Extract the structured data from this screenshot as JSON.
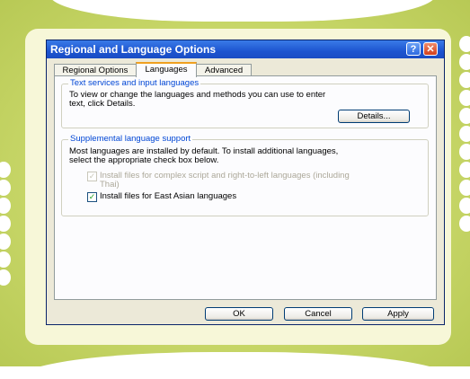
{
  "window": {
    "title": "Regional and Language Options",
    "help_label": "?",
    "close_label": "✕"
  },
  "tabs": [
    {
      "label": "Regional Options",
      "active": false
    },
    {
      "label": "Languages",
      "active": true
    },
    {
      "label": "Advanced",
      "active": false
    }
  ],
  "text_services": {
    "legend": "Text services and input languages",
    "desc_line1": "To view or change the languages and methods you can use to enter",
    "desc_line2": "text, click Details.",
    "details_label": "Details..."
  },
  "supplemental": {
    "legend": "Supplemental language support",
    "desc_line1": "Most languages are installed by default. To install additional languages,",
    "desc_line2": "select the appropriate check box below.",
    "complex_line1": "Install files for complex script and right-to-left languages (including",
    "complex_line2": "Thai)",
    "complex_checked": true,
    "complex_enabled": false,
    "east_asian_label": "Install files for East Asian languages",
    "east_asian_checked": true,
    "check_glyph": "✓"
  },
  "footer": {
    "ok_label": "OK",
    "cancel_label": "Cancel",
    "apply_label": "Apply"
  }
}
